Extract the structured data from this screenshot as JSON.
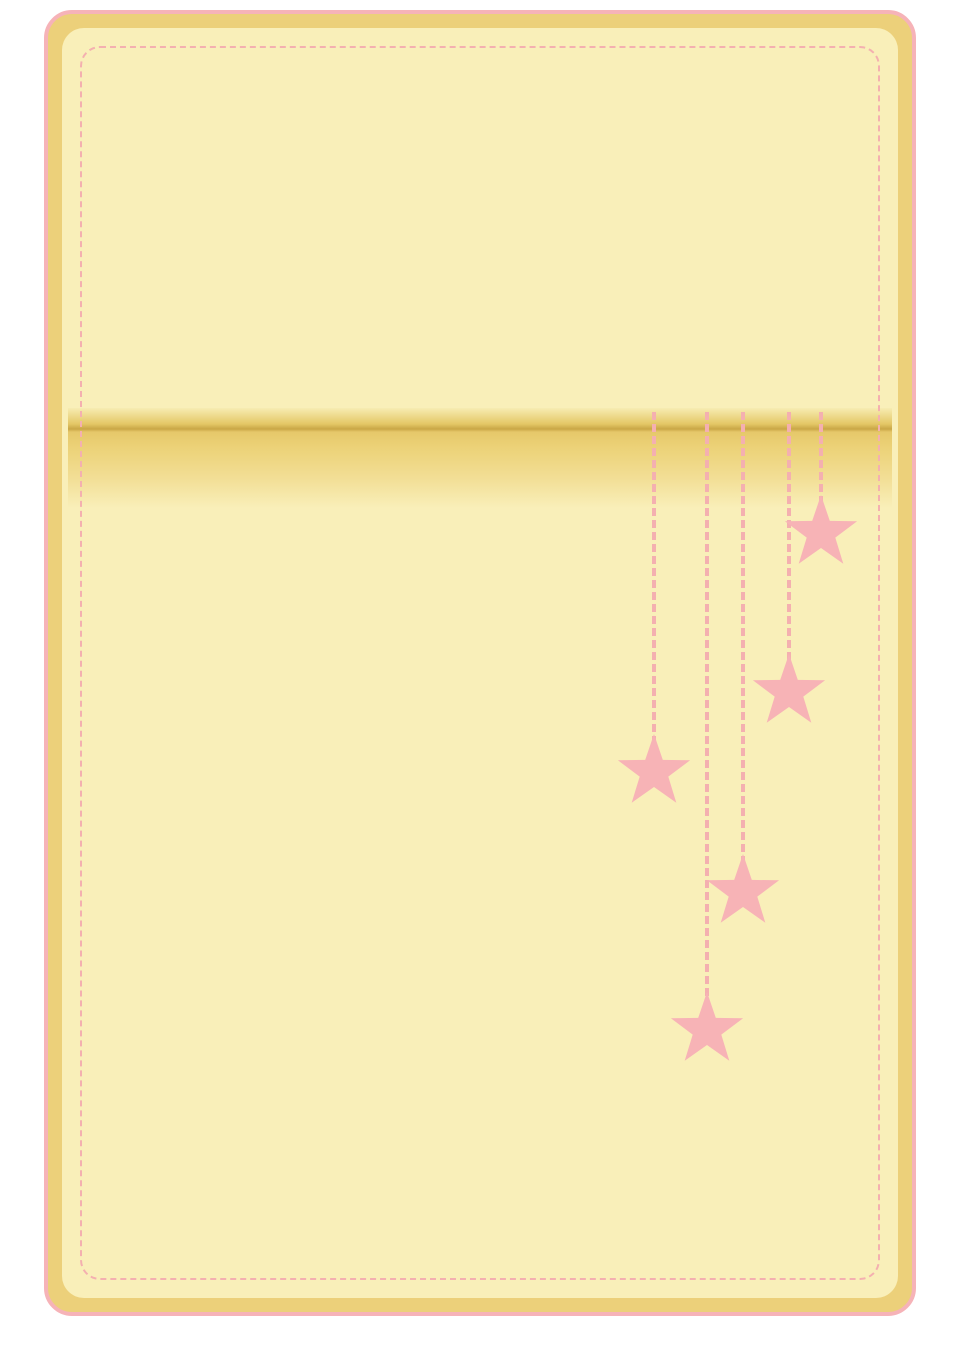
{
  "card": {
    "border_color": "#f6b3b8",
    "frame_color": "#ecd07a",
    "paper_color": "#f9efb9",
    "fold_shadow_color": "#c9a646",
    "stitch_color": "#f4b0b0"
  },
  "decoration": {
    "star_icon": "star-icon",
    "star_color": "#f7b3b6",
    "string_color": "#f4b0b0",
    "star_count": 5
  }
}
